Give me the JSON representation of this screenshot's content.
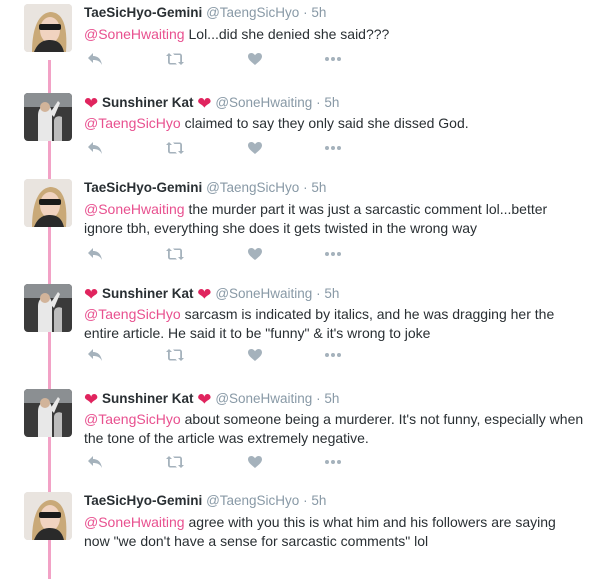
{
  "colors": {
    "thread_line": "#f2a2c6",
    "mention": "#e8508f",
    "heart": "#e0245e",
    "action_icon": "#a5b2bc",
    "name": "#292f33",
    "meta": "#8899a6"
  },
  "icons": {
    "reply": "reply-icon",
    "retweet": "retweet-icon",
    "like": "heart-icon",
    "more": "more-icon",
    "name_decoration": "red-heart-emoji"
  },
  "tweets": [
    {
      "name": "TaeSicHyo-Gemini",
      "handle": "@TaengSicHyo",
      "time": "5h",
      "mention": "@SoneHwaiting",
      "text": " Lol...did she denied she said???"
    },
    {
      "name": "Sunshiner Kat",
      "heart": "❤",
      "handle": "@SoneHwaiting",
      "time": "5h",
      "mention": "@TaengSicHyo",
      "text": " claimed to say they only said she dissed God."
    },
    {
      "name": "TaeSicHyo-Gemini",
      "handle": "@TaengSicHyo",
      "time": "5h",
      "mention": "@SoneHwaiting",
      "text": " the murder part it was just a sarcastic comment lol...better ignore tbh, everything she does it gets twisted in the wrong way"
    },
    {
      "name": "Sunshiner Kat",
      "heart": "❤",
      "handle": "@SoneHwaiting",
      "time": "5h",
      "mention": "@TaengSicHyo",
      "text": " sarcasm is indicated by italics, and he was dragging her the entire article. He said it to be \"funny\" & it's wrong to joke"
    },
    {
      "name": "Sunshiner Kat",
      "heart": "❤",
      "handle": "@SoneHwaiting",
      "time": "5h",
      "mention": "@TaengSicHyo",
      "text": " about someone being a murderer. It's not funny, especially when the tone of the article was extremely negative."
    },
    {
      "name": "TaeSicHyo-Gemini",
      "handle": "@TaengSicHyo",
      "time": "5h",
      "mention": "@SoneHwaiting",
      "text": " agree with you this is what him and his followers are saying now \"we don't have a sense for sarcastic comments\" lol"
    }
  ]
}
